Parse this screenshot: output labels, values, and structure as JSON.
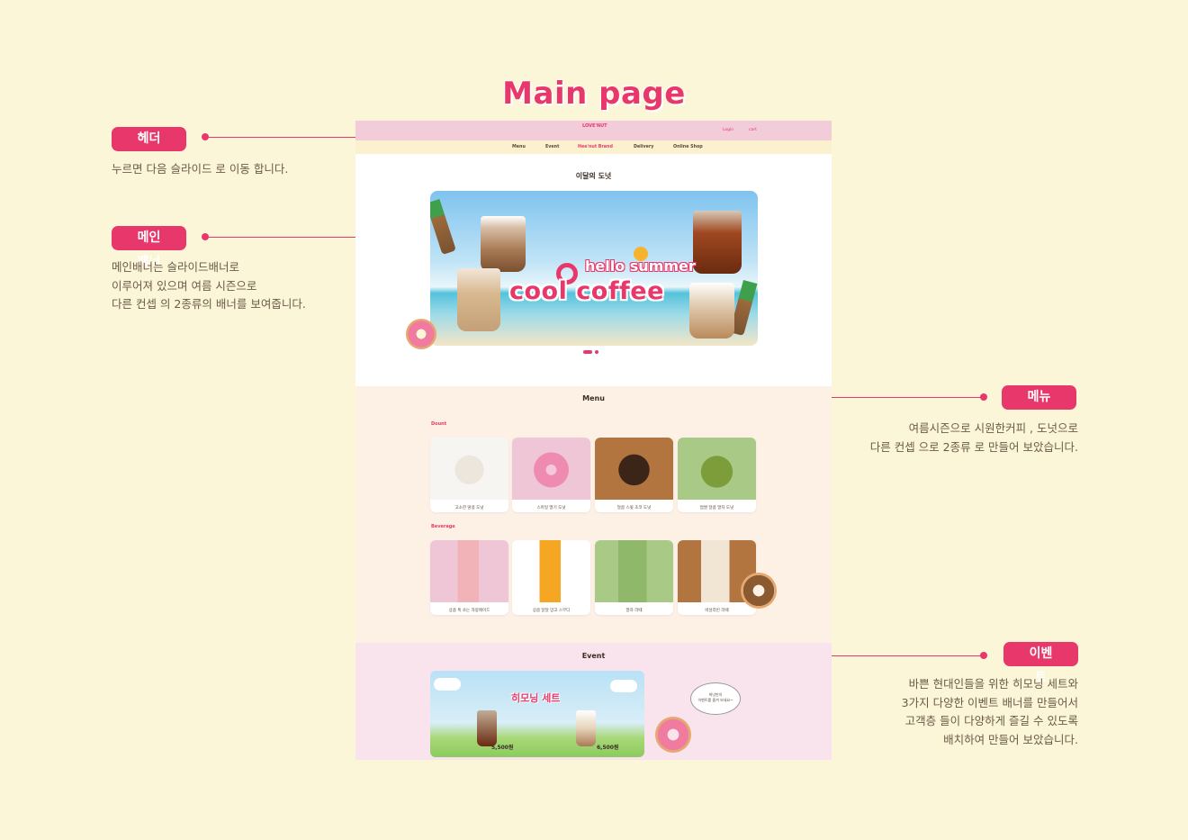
{
  "page_title": "Main page",
  "annotations": {
    "header": {
      "label": "헤더",
      "desc": "누르면 다음 슬라이드 로 이동 합니다."
    },
    "main_banner": {
      "label": "메인배너",
      "desc": "메인배너는 슬라이드배너로\n이루어져 있으며 여름 시즌으로\n다른 컨셉 의 2종류의 배너를 보여줍니다."
    },
    "menu": {
      "label": "메뉴",
      "desc": "여름시즌으로 시원한커피 , 도넛으로\n다른 컨셉 으로 2종류 로 만들어 보았습니다."
    },
    "event": {
      "label": "이벤트",
      "desc": "바쁜 현대인들을 위한  히모닝 세트와\n3가지 다양한 이벤트 배너를 만들어서\n고객층 들이 다양하게 즐길 수 있도록\n배치하여 만들어 보았습니다."
    }
  },
  "site": {
    "logo": "LOVE'NUT",
    "header_links": {
      "login": "Login",
      "cart": "cart"
    },
    "nav": [
      "Menu",
      "Event",
      "Hee'nut Brand",
      "Delivery",
      "Online Shop"
    ],
    "nav_active": "Hee'nut Brand",
    "banner_section_title": "이달의 도넛",
    "banner": {
      "line1": "hello summer",
      "line2": "cool coffee"
    },
    "menu_section": {
      "title": "Menu",
      "donut_label": "Dount",
      "donuts": [
        "고소한 땅콩 도넛",
        "스마일 딸기 도넛",
        "달콤 스윗 초코 도넛",
        "쌉쌀 달콤 말차 도넛"
      ],
      "beverage_label": "Beverage",
      "beverages": [
        "상큼 톡 쏘는 자몽에이드",
        "상큼 달달 망고 스무디",
        "말차 라떼",
        "바닐라빈 라떼"
      ]
    },
    "event_section": {
      "title": "Event",
      "banner_title": "히모닝 세트",
      "price1": "5,500원",
      "price2": "6,500원",
      "speech": "희넛만의\n이벤트를 즐겨 보세요~"
    }
  },
  "colors": {
    "accent": "#e8386b",
    "background": "#fbf6d8",
    "header": "#f2ccd9",
    "nav": "#fcf1cf"
  }
}
